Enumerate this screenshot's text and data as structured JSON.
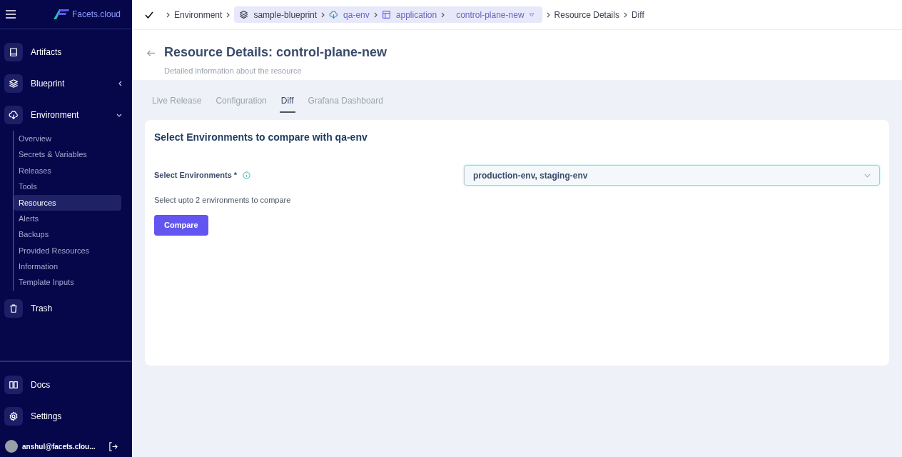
{
  "sidebar": {
    "logo": "Facets.cloud",
    "items": [
      {
        "label": "Artifacts",
        "kind": "book"
      },
      {
        "label": "Blueprint",
        "kind": "layers",
        "expanded": false
      },
      {
        "label": "Environment",
        "kind": "cloud",
        "expanded": true,
        "children": [
          {
            "label": "Overview",
            "selected": false
          },
          {
            "label": "Secrets & Variables",
            "selected": false
          },
          {
            "label": "Releases",
            "selected": false
          },
          {
            "label": "Tools",
            "selected": false
          },
          {
            "label": "Resources",
            "selected": true
          },
          {
            "label": "Alerts",
            "selected": false
          },
          {
            "label": "Backups",
            "selected": false
          },
          {
            "label": "Provided Resources",
            "selected": false
          },
          {
            "label": "Information",
            "selected": false
          },
          {
            "label": "Template Inputs",
            "selected": false
          }
        ]
      },
      {
        "label": "Trash",
        "kind": "trash"
      }
    ],
    "bottom_items": [
      {
        "label": "Docs",
        "kind": "book-open"
      },
      {
        "label": "Settings",
        "kind": "gear"
      }
    ],
    "user": "anshul@facets.clou..."
  },
  "breadcrumbs": [
    {
      "label": "Environment",
      "kind": "plain"
    },
    {
      "label": "sample-blueprint",
      "kind": "blueprint"
    },
    {
      "label": "qa-env",
      "kind": "environment"
    },
    {
      "label": "application",
      "kind": "resource-type"
    },
    {
      "label": "control-plane-new",
      "kind": "resource"
    },
    {
      "label": "Resource Details",
      "kind": "plain"
    },
    {
      "label": "Diff",
      "kind": "plain"
    }
  ],
  "header": {
    "title": "Resource Details: control-plane-new",
    "subtitle": "Detailed information about the resource"
  },
  "tabs": [
    {
      "label": "Live Release",
      "selected": false
    },
    {
      "label": "Configuration",
      "selected": false
    },
    {
      "label": "Diff",
      "selected": true
    },
    {
      "label": "Grafana Dashboard",
      "selected": false
    }
  ],
  "card": {
    "title": "Select Environments to compare with qa-env",
    "field_label": "Select Environments *",
    "value": "production-env, staging-env",
    "hint": "Select upto 2 environments to compare",
    "button": "Compare"
  }
}
